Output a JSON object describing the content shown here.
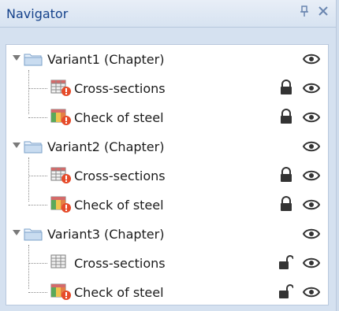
{
  "window": {
    "title": "Navigator",
    "pin_icon": "pin-icon",
    "close_icon": "close-icon",
    "colors": {
      "header_text": "#15428b",
      "panel_bg": "#d5e1f0",
      "content_bg": "#ffffff"
    }
  },
  "tree": {
    "chapters": [
      {
        "label": "Variant1 (Chapter)",
        "icon": "folder-icon",
        "children": [
          {
            "label": "Cross-sections",
            "icon": "sections-grid-warning-icon",
            "locked": true
          },
          {
            "label": "Check of steel",
            "icon": "steel-check-warning-icon",
            "locked": true
          }
        ]
      },
      {
        "label": "Variant2 (Chapter)",
        "icon": "folder-icon",
        "children": [
          {
            "label": "Cross-sections",
            "icon": "sections-grid-warning-icon",
            "locked": true
          },
          {
            "label": "Check of steel",
            "icon": "steel-check-warning-icon",
            "locked": true
          }
        ]
      },
      {
        "label": "Variant3 (Chapter)",
        "icon": "folder-icon",
        "children": [
          {
            "label": "Cross-sections",
            "icon": "sections-grid-icon",
            "locked": false
          },
          {
            "label": "Check of steel",
            "icon": "steel-check-warning-icon",
            "locked": false
          }
        ]
      }
    ]
  }
}
